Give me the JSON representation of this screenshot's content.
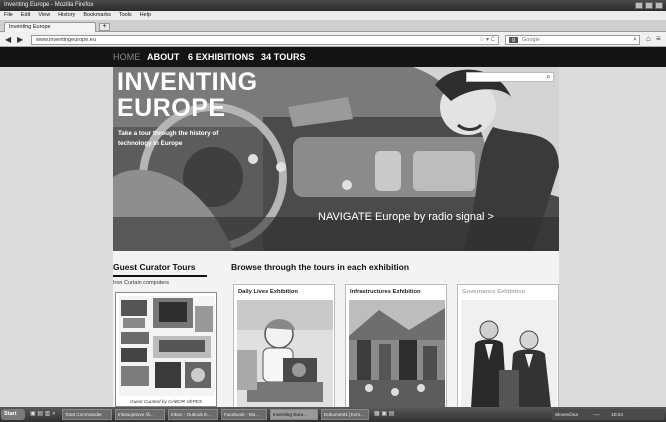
{
  "window": {
    "title": "Inventing Europe - Mozilla Firefox"
  },
  "menubar": {
    "items": [
      "File",
      "Edit",
      "View",
      "History",
      "Bookmarks",
      "Tools",
      "Help"
    ]
  },
  "tabs": [
    {
      "label": "Inventing Europe",
      "active": true
    }
  ],
  "navbar": {
    "url": "www.inventingeurope.eu",
    "search_placeholder": "Google"
  },
  "site": {
    "nav": [
      "HOME",
      "ABOUT",
      "6 EXHIBITIONS",
      "34 TOURS"
    ],
    "hero": {
      "title_line1": "INVENTING",
      "title_line2": "EUROPE",
      "tagline": "Take a tour through the history of technology in Europe",
      "cta": "NAVIGATE Europe by radio signal >"
    },
    "guest_curator": {
      "heading": "Guest Curator Tours",
      "subheading": "Iron Curtain computers",
      "credit": "Guest Curated by GÁBOR VÉPES"
    },
    "browse": {
      "heading": "Browse through the tours in each exhibition",
      "exhibitions": [
        {
          "title": "Daily Lives Exhibition"
        },
        {
          "title": "Infrastructures Exhibition"
        },
        {
          "title": "Governance Exhibition"
        }
      ]
    }
  },
  "taskbar": {
    "start": "Start",
    "tasks": [
      {
        "label": "Total Commander",
        "active": false
      },
      {
        "label": "Inkasujetove rå...",
        "active": false
      },
      {
        "label": "Inbox - Outlook E...",
        "active": false
      },
      {
        "label": "Facebook - Mo...",
        "active": false
      },
      {
        "label": "Inventing Euro...",
        "active": true
      },
      {
        "label": "Dokument1 [Kom...",
        "active": false
      }
    ],
    "tray_text": "Slovenčina",
    "clock": "10:24"
  }
}
